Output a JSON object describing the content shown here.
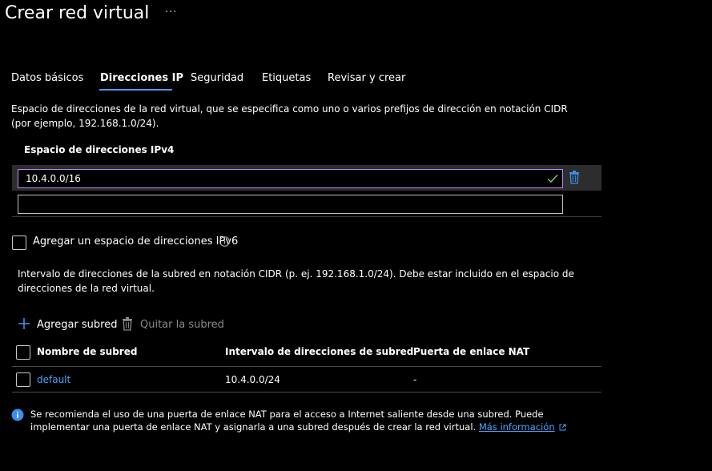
{
  "page": {
    "title": "Crear red virtual",
    "more_label": "···"
  },
  "tabs": [
    {
      "label": "Datos básicos",
      "active": false
    },
    {
      "label": "Direcciones IP",
      "active": true
    },
    {
      "label": "Seguridad",
      "active": false
    },
    {
      "label": "Etiquetas",
      "active": false
    },
    {
      "label": "Revisar y crear",
      "active": false
    }
  ],
  "address_space": {
    "description": "Espacio de direcciones de la red virtual, que se especifica como uno o varios prefijos de dirección en notación CIDR (por ejemplo, 192.168.1.0/24).",
    "label": "Espacio de direcciones IPv4",
    "entries": [
      "10.4.0.0/16",
      ""
    ]
  },
  "ipv6": {
    "checkbox_label": "Agregar un espacio de direcciones IPv6",
    "checked": false
  },
  "subnets": {
    "description": "Intervalo de direcciones de la subred en notación CIDR (p. ej. 192.168.1.0/24). Debe estar incluido en el espacio de direcciones de la red virtual.",
    "add_label": "Agregar subred",
    "remove_label": "Quitar la subred",
    "columns": [
      "Nombre de subred",
      "Intervalo de direcciones de subred",
      "Puerta de enlace NAT"
    ],
    "rows": [
      {
        "name": "default",
        "range": "10.4.0.0/24",
        "nat": "-"
      }
    ]
  },
  "info_banner": {
    "text": "Se recomienda el uso de una puerta de enlace NAT para el acceso a Internet saliente desde una subred. Puede implementar una puerta de enlace NAT y asignarla a una subred después de crear la red virtual. ",
    "link_text": "Más información"
  },
  "colors": {
    "accent": "#4a9eff",
    "link": "#4aa3ff",
    "focus_border": "#c084fc",
    "valid_check": "#7fd17f",
    "info_icon": "#3b8eea"
  }
}
